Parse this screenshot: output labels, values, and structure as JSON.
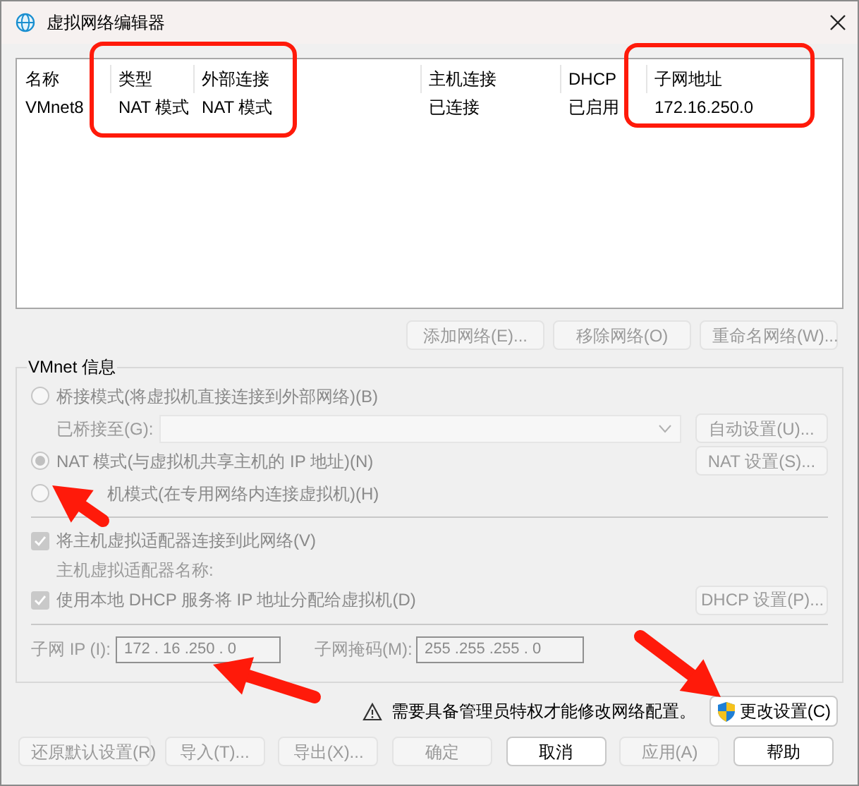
{
  "window": {
    "title": "虚拟网络编辑器"
  },
  "networks": {
    "columns": [
      "名称",
      "类型",
      "外部连接",
      "主机连接",
      "DHCP",
      "子网地址"
    ],
    "rows": [
      {
        "cells": [
          "VMnet8",
          "NAT 模式",
          "NAT 模式",
          "已连接",
          "已启用",
          "172.16.250.0"
        ]
      }
    ]
  },
  "list_buttons": [
    {
      "label": "添加网络(E)...",
      "disabled": true
    },
    {
      "label": "移除网络(O)",
      "disabled": true
    },
    {
      "label": "重命名网络(W)...",
      "disabled": true
    }
  ],
  "vmnet_info": {
    "legend": "VMnet 信息",
    "bridged": {
      "label": "桥接模式(将虚拟机直接连接到外部网络)(B)",
      "selected": false,
      "disabled": true
    },
    "bridged_to": {
      "label": "已桥接至(G):",
      "button": "自动设置(U)..."
    },
    "nat": {
      "label": "NAT 模式(与虚拟机共享主机的 IP 地址)(N)",
      "selected": true,
      "disabled": true,
      "button": "NAT 设置(S)..."
    },
    "host_only": {
      "label": "机模式(在专用网络内连接虚拟机)(H)",
      "selected": false,
      "disabled": true
    },
    "host_adapter": {
      "label": "将主机虚拟适配器连接到此网络(V)",
      "checked": true,
      "disabled": true
    },
    "adapter_name_label": "主机虚拟适配器名称:",
    "dhcp": {
      "label": "使用本地 DHCP 服务将 IP 地址分配给虚拟机(D)",
      "checked": true,
      "disabled": true,
      "button": "DHCP 设置(P)..."
    },
    "subnet_ip": {
      "label": "子网 IP (I):",
      "value": "172 . 16 .250 . 0"
    },
    "subnet_mask": {
      "label": "子网掩码(M):",
      "value": "255 .255 .255 . 0"
    }
  },
  "admin_notice": "需要具备管理员特权才能修改网络配置。",
  "change_settings_button": "更改设置(C)",
  "footer_buttons": [
    {
      "label": "还原默认设置(R)",
      "disabled": true
    },
    {
      "label": "导入(T)...",
      "disabled": true
    },
    {
      "label": "导出(X)...",
      "disabled": true
    },
    {
      "label": "确定",
      "disabled": true
    },
    {
      "label": "取消",
      "disabled": false
    },
    {
      "label": "应用(A)",
      "disabled": true
    },
    {
      "label": "帮助",
      "disabled": false
    }
  ]
}
